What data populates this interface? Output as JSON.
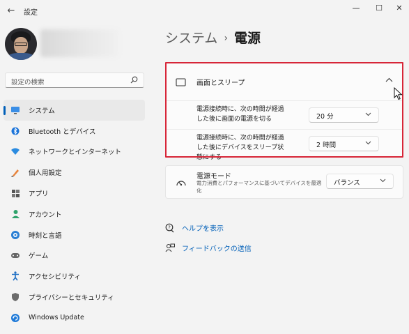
{
  "window": {
    "title": "設定",
    "back_glyph": "←",
    "minimize_glyph": "—",
    "maximize_glyph": "☐",
    "close_glyph": "✕"
  },
  "search": {
    "placeholder": "設定の検索",
    "icon": "search-icon"
  },
  "sidebar": {
    "items": [
      {
        "label": "システム",
        "icon": "system-icon",
        "active": true
      },
      {
        "label": "Bluetooth とデバイス",
        "icon": "bluetooth-icon"
      },
      {
        "label": "ネットワークとインターネット",
        "icon": "network-icon"
      },
      {
        "label": "個人用設定",
        "icon": "personalization-icon"
      },
      {
        "label": "アプリ",
        "icon": "apps-icon"
      },
      {
        "label": "アカウント",
        "icon": "account-icon"
      },
      {
        "label": "時刻と言語",
        "icon": "time-language-icon"
      },
      {
        "label": "ゲーム",
        "icon": "gaming-icon"
      },
      {
        "label": "アクセシビリティ",
        "icon": "accessibility-icon"
      },
      {
        "label": "プライバシーとセキュリティ",
        "icon": "privacy-icon"
      },
      {
        "label": "Windows Update",
        "icon": "windows-update-icon"
      }
    ]
  },
  "breadcrumb": {
    "parent": "システム",
    "separator": "›",
    "current": "電源"
  },
  "screen_sleep": {
    "title": "画面とスリープ",
    "collapse_glyph": "︿",
    "rows": [
      {
        "label": "電源接続時に、次の時間が経過した後に画面の電源を切る",
        "value": "20 分"
      },
      {
        "label": "電源接続時に、次の時間が経過した後にデバイスをスリープ状態にする",
        "value": "2 時間"
      }
    ],
    "chevron_glyph": "⌄"
  },
  "power_mode": {
    "title": "電源モード",
    "description": "電力消費とパフォーマンスに基づいてデバイスを最適化",
    "value": "バランス"
  },
  "links": {
    "help": "ヘルプを表示",
    "feedback": "フィードバックの送信"
  },
  "colors": {
    "accent": "#005fb8",
    "highlight_border": "#d72638",
    "background": "#f3f3f3",
    "card": "#fbfbfb"
  }
}
